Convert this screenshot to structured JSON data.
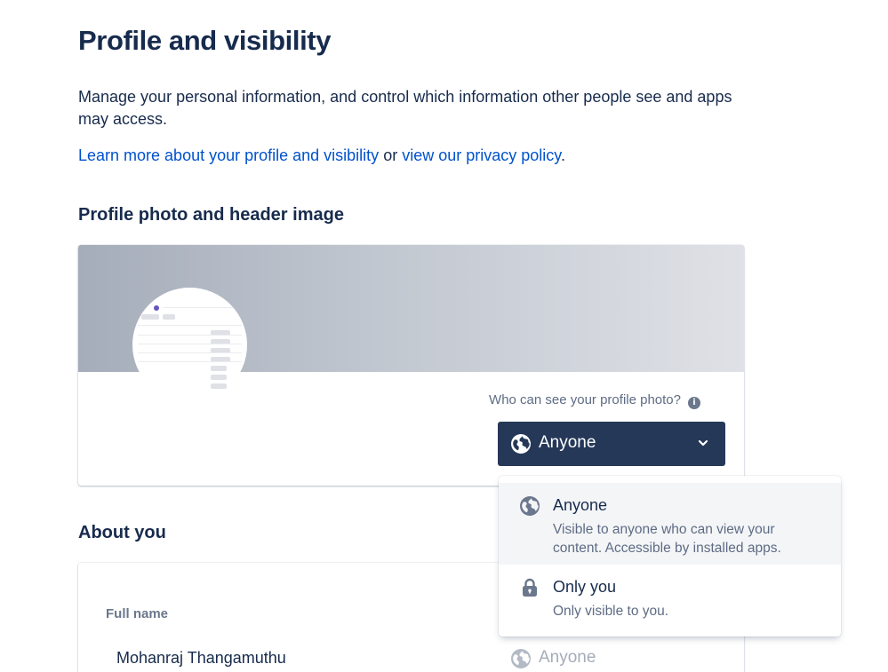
{
  "page": {
    "title": "Profile and visibility",
    "intro": "Manage your personal information, and control which information other people see and apps may access.",
    "learn_more_link": "Learn more about your profile and visibility",
    "or_text": " or ",
    "privacy_link": "view our privacy policy",
    "period": "."
  },
  "photo_section": {
    "title": "Profile photo and header image",
    "who_can_see_label": "Who can see your profile photo?",
    "info_icon": "info-icon",
    "selected_visibility": "Anyone",
    "selected_icon": "globe-icon"
  },
  "about_section": {
    "title": "About you",
    "fields": [
      {
        "label": "Full name",
        "value": "Mohanraj Thangamuthu",
        "visibility": "Anyone"
      }
    ]
  },
  "visibility_menu": {
    "options": [
      {
        "title": "Anyone",
        "description": "Visible to anyone who can view your content. Accessible by installed apps.",
        "icon": "globe-icon",
        "highlighted": true
      },
      {
        "title": "Only you",
        "description": "Only visible to you.",
        "icon": "lock-icon",
        "highlighted": false
      }
    ]
  },
  "colors": {
    "text": "#172b4d",
    "link": "#0052cc",
    "button_bg": "#253858",
    "muted": "#5e6c84",
    "menu_highlight": "#f4f5f7"
  }
}
